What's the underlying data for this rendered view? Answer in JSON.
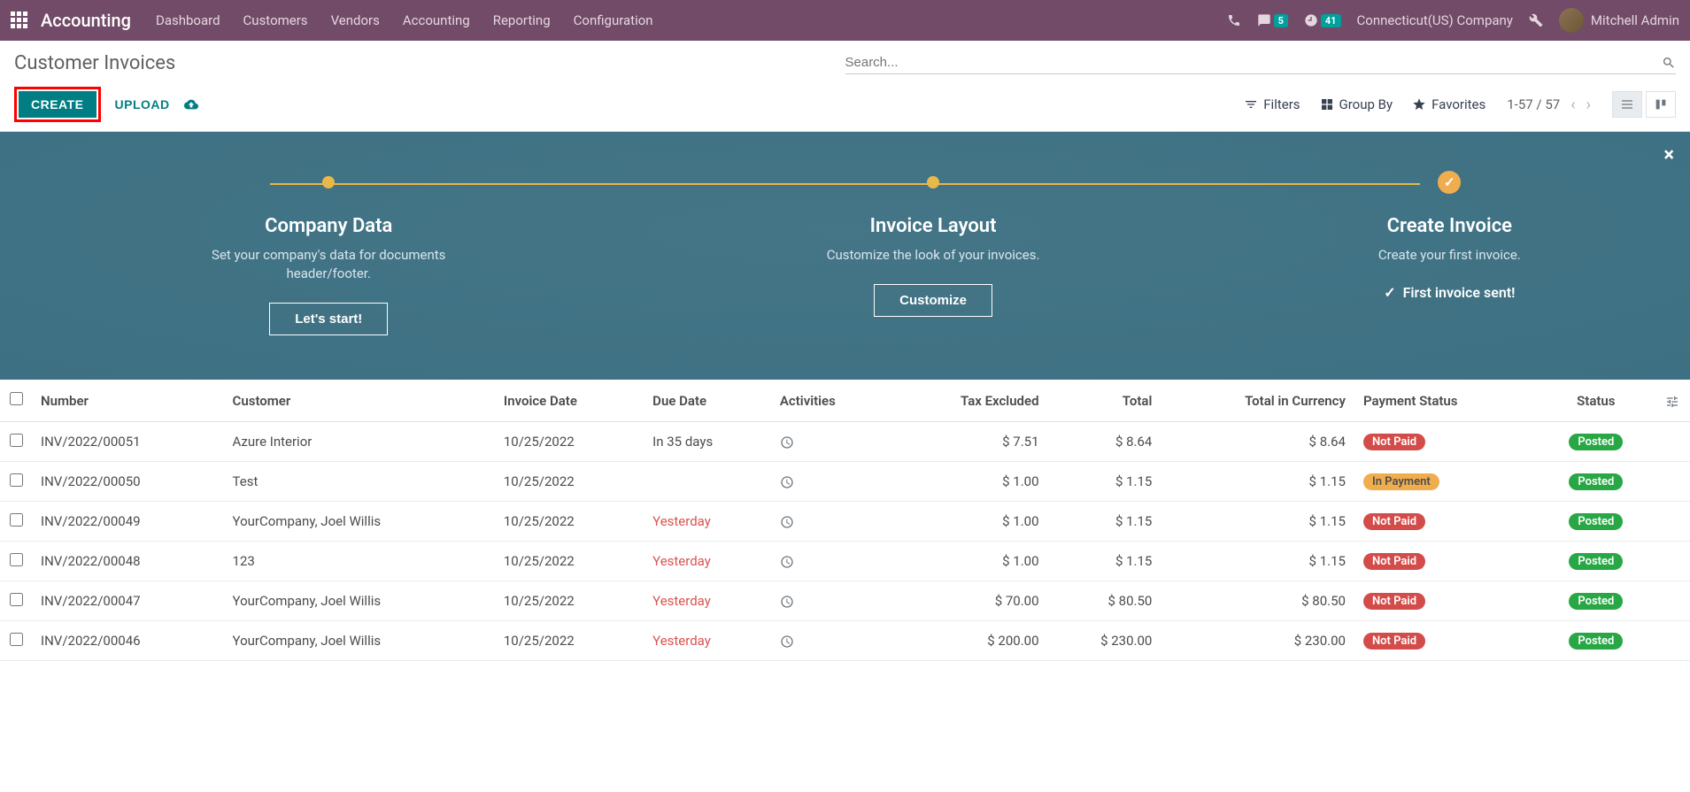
{
  "navbar": {
    "brand": "Accounting",
    "links": [
      "Dashboard",
      "Customers",
      "Vendors",
      "Accounting",
      "Reporting",
      "Configuration"
    ],
    "msg_badge": "5",
    "clock_badge": "41",
    "company": "Connecticut(US) Company",
    "user": "Mitchell Admin"
  },
  "page": {
    "title": "Customer Invoices",
    "search_placeholder": "Search...",
    "create": "CREATE",
    "upload": "UPLOAD",
    "filters": "Filters",
    "groupby": "Group By",
    "favorites": "Favorites",
    "pager": "1-57 / 57"
  },
  "banner": {
    "step1": {
      "title": "Company Data",
      "desc": "Set your company's data for documents header/footer.",
      "btn": "Let's start!"
    },
    "step2": {
      "title": "Invoice Layout",
      "desc": "Customize the look of your invoices.",
      "btn": "Customize"
    },
    "step3": {
      "title": "Create Invoice",
      "desc": "Create your first invoice.",
      "done": "First invoice sent!"
    }
  },
  "table": {
    "headers": {
      "number": "Number",
      "customer": "Customer",
      "invdate": "Invoice Date",
      "duedate": "Due Date",
      "activities": "Activities",
      "taxex": "Tax Excluded",
      "total": "Total",
      "totcur": "Total in Currency",
      "paystatus": "Payment Status",
      "status": "Status"
    },
    "rows": [
      {
        "number": "INV/2022/00051",
        "customer": "Azure Interior",
        "invdate": "10/25/2022",
        "duedate": "In 35 days",
        "due_over": false,
        "taxex": "$ 7.51",
        "total": "$ 8.64",
        "totcur": "$ 8.64",
        "pay": "Not Paid",
        "pay_cls": "notpaid",
        "status": "Posted"
      },
      {
        "number": "INV/2022/00050",
        "customer": "Test",
        "invdate": "10/25/2022",
        "duedate": "",
        "due_over": false,
        "taxex": "$ 1.00",
        "total": "$ 1.15",
        "totcur": "$ 1.15",
        "pay": "In Payment",
        "pay_cls": "inpay",
        "status": "Posted"
      },
      {
        "number": "INV/2022/00049",
        "customer": "YourCompany, Joel Willis",
        "invdate": "10/25/2022",
        "duedate": "Yesterday",
        "due_over": true,
        "taxex": "$ 1.00",
        "total": "$ 1.15",
        "totcur": "$ 1.15",
        "pay": "Not Paid",
        "pay_cls": "notpaid",
        "status": "Posted"
      },
      {
        "number": "INV/2022/00048",
        "customer": "123",
        "invdate": "10/25/2022",
        "duedate": "Yesterday",
        "due_over": true,
        "taxex": "$ 1.00",
        "total": "$ 1.15",
        "totcur": "$ 1.15",
        "pay": "Not Paid",
        "pay_cls": "notpaid",
        "status": "Posted"
      },
      {
        "number": "INV/2022/00047",
        "customer": "YourCompany, Joel Willis",
        "invdate": "10/25/2022",
        "duedate": "Yesterday",
        "due_over": true,
        "taxex": "$ 70.00",
        "total": "$ 80.50",
        "totcur": "$ 80.50",
        "pay": "Not Paid",
        "pay_cls": "notpaid",
        "status": "Posted"
      },
      {
        "number": "INV/2022/00046",
        "customer": "YourCompany, Joel Willis",
        "invdate": "10/25/2022",
        "duedate": "Yesterday",
        "due_over": true,
        "taxex": "$ 200.00",
        "total": "$ 230.00",
        "totcur": "$ 230.00",
        "pay": "Not Paid",
        "pay_cls": "notpaid",
        "status": "Posted"
      }
    ]
  }
}
